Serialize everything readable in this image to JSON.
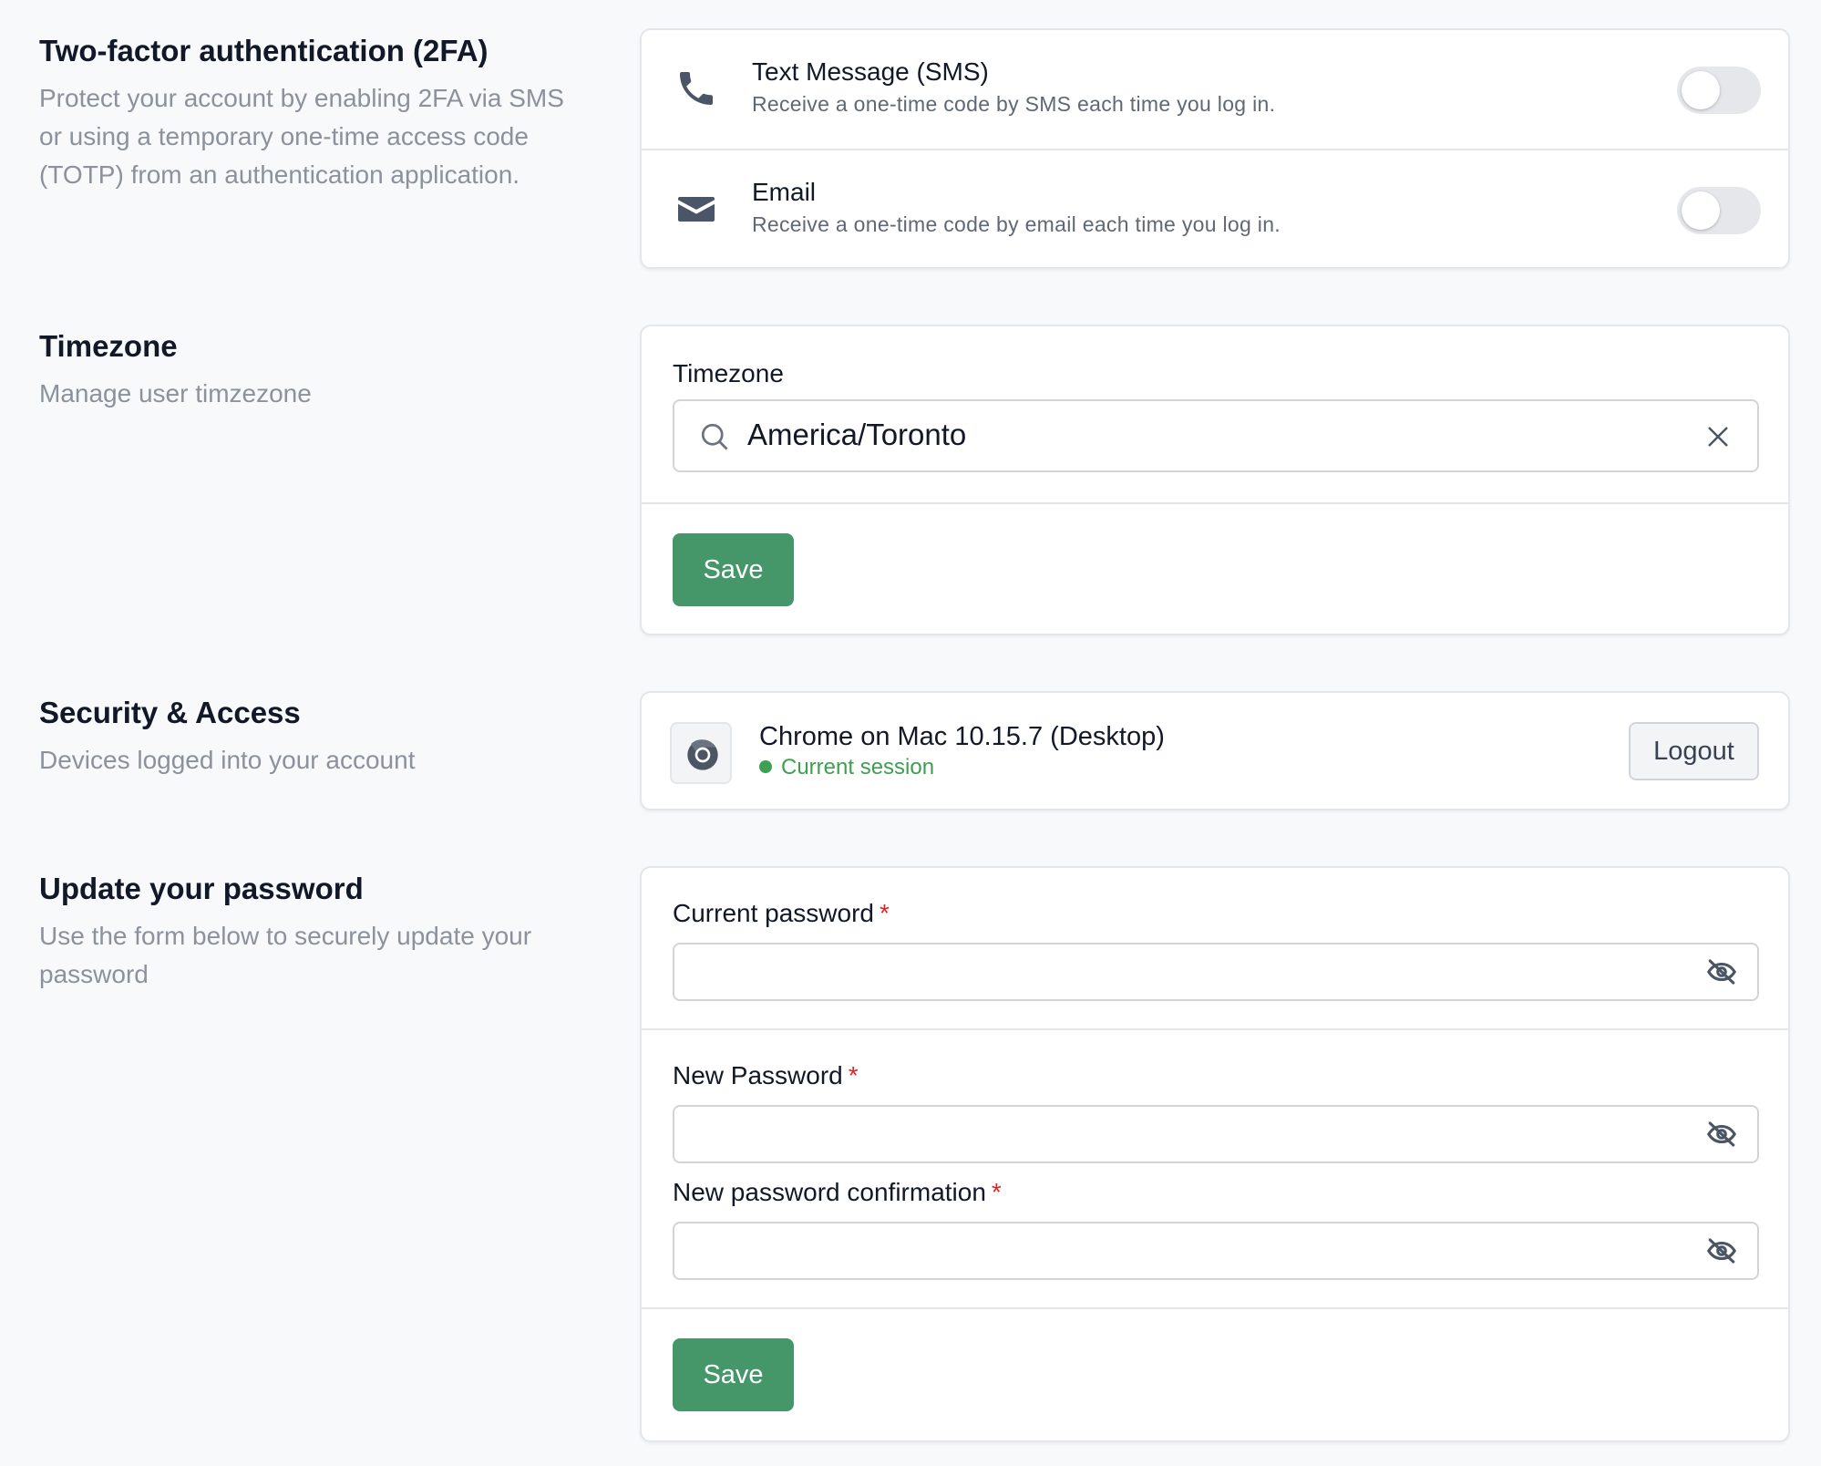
{
  "two_factor": {
    "title": "Two-factor authentication (2FA)",
    "description": "Protect your account by enabling 2FA via SMS or using a temporary one-time access code (TOTP) from an authentication application.",
    "options": [
      {
        "title": "Text Message (SMS)",
        "subtitle": "Receive a one-time code by SMS each time you log in.",
        "icon": "phone-icon",
        "enabled": false
      },
      {
        "title": "Email",
        "subtitle": "Receive a one-time code by email each time you log in.",
        "icon": "envelope-icon",
        "enabled": false
      }
    ]
  },
  "timezone": {
    "title": "Timezone",
    "description": "Manage user timzezone",
    "field_label": "Timezone",
    "value": "America/Toronto",
    "save_label": "Save"
  },
  "security": {
    "title": "Security & Access",
    "description": "Devices logged into your account",
    "session": {
      "browser_icon": "chrome-icon",
      "name": "Chrome on Mac 10.15.7 (Desktop)",
      "status": "Current session",
      "logout_label": "Logout"
    }
  },
  "password": {
    "title": "Update your password",
    "description": "Use the form below to securely update your password",
    "current_label": "Current password",
    "new_label": "New Password",
    "confirm_label": "New password confirmation",
    "required_marker": "*",
    "save_label": "Save"
  },
  "colors": {
    "primary_button": "#459669",
    "status_green": "#3ea151",
    "required_red": "#dc2626"
  }
}
